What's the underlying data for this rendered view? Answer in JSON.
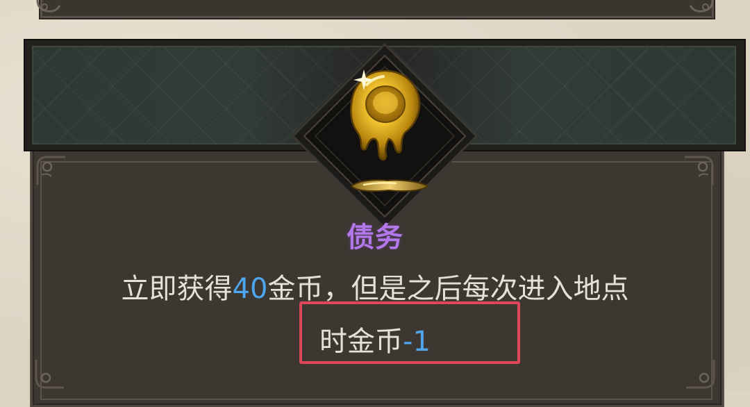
{
  "event": {
    "title": "债务",
    "description": {
      "line1_prefix": "立即获得",
      "line1_number": "40",
      "line1_suffix": "金币，但是之后每次进入地点",
      "line2_prefix": "时金币",
      "line2_number": "-1"
    },
    "icon": "melting-gold-coin-icon"
  },
  "colors": {
    "title": "#b277e8",
    "number": "#4ea6ee",
    "text": "#e6e0d5",
    "highlight": "#e0465a",
    "panel": "#3d3731"
  }
}
